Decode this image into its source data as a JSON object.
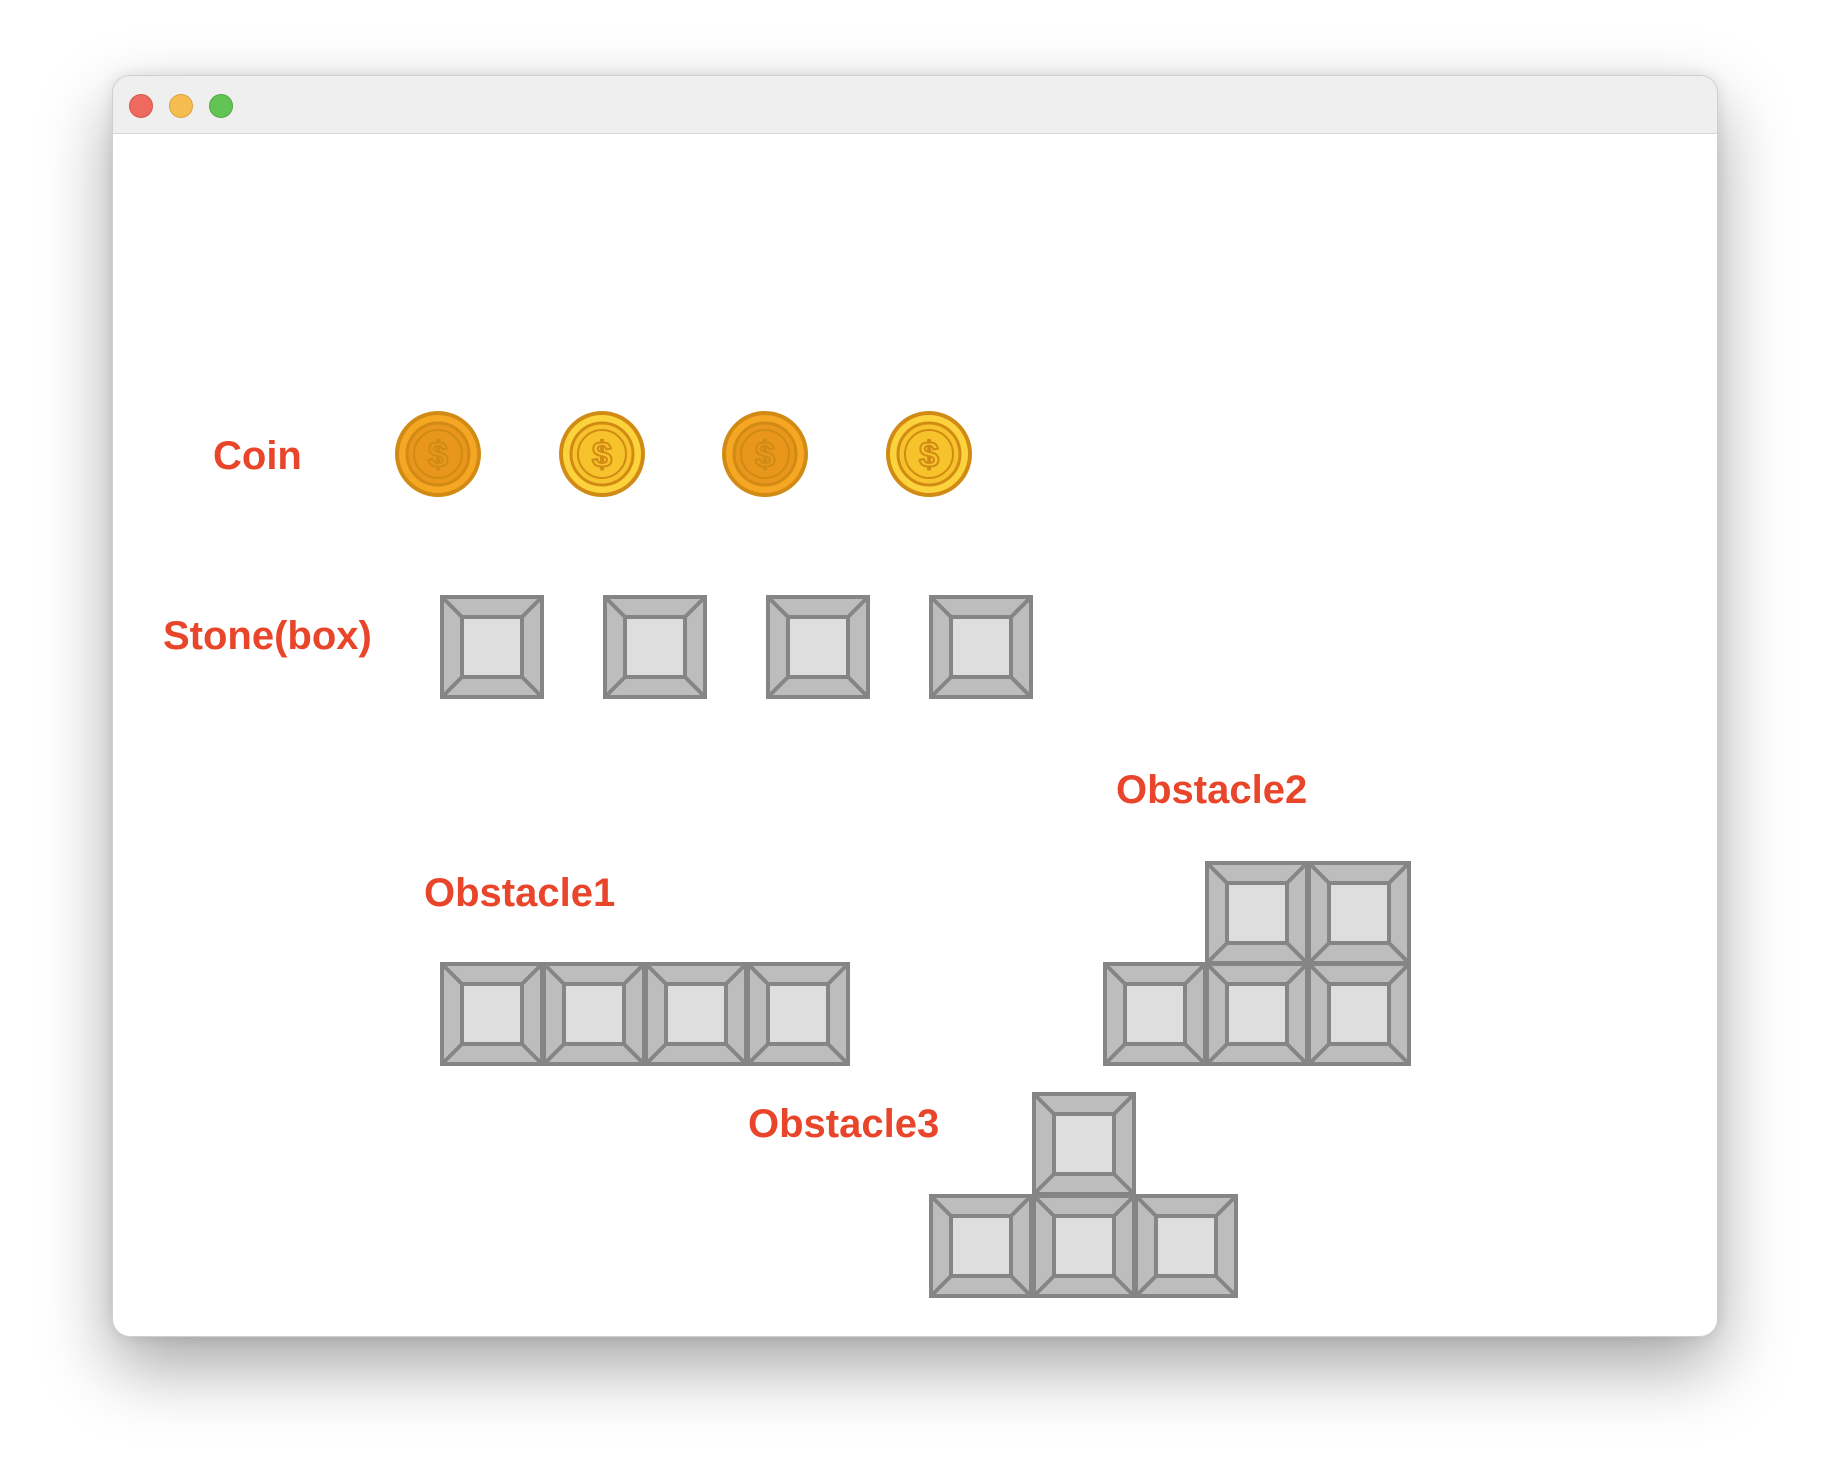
{
  "window": {
    "traffic_lights": [
      "close",
      "minimize",
      "zoom"
    ]
  },
  "colors": {
    "label": "#e8452a",
    "stone_border": "#858585",
    "stone_bevel": "#bdbdbd",
    "stone_face": "#dedede",
    "coin_orange": "#f5a623",
    "coin_yellow": "#fcd33c",
    "coin_outline": "#d18b14"
  },
  "labels": {
    "coin": "Coin",
    "stone": "Stone(box)",
    "obstacle1": "Obstacle1",
    "obstacle2": "Obstacle2",
    "obstacle3": "Obstacle3"
  },
  "sprites": {
    "coins": [
      {
        "variant": "orange",
        "icon": "dollar-coin-icon"
      },
      {
        "variant": "yellow",
        "icon": "dollar-coin-icon"
      },
      {
        "variant": "orange",
        "icon": "dollar-coin-icon"
      },
      {
        "variant": "yellow",
        "icon": "dollar-coin-icon"
      }
    ],
    "stone_count": 4,
    "obstacle1_block_count": 4,
    "obstacle2_block_count": 5,
    "obstacle3_block_count": 4
  }
}
